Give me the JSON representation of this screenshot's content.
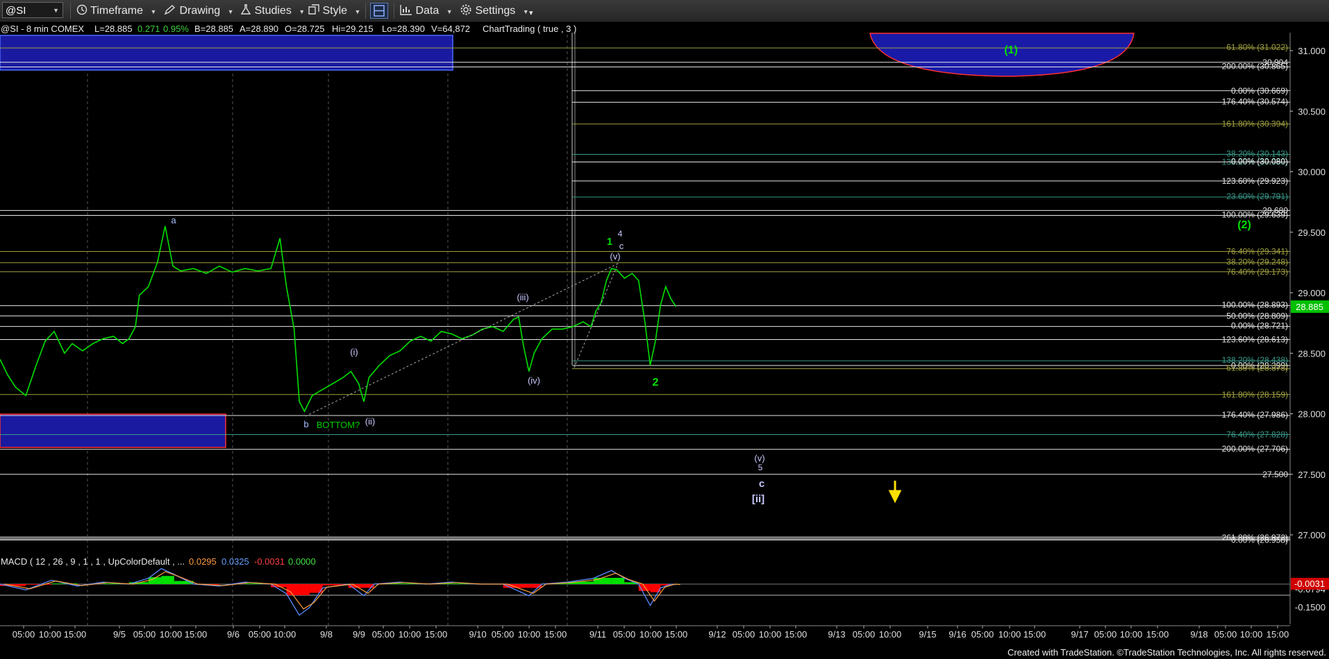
{
  "toolbar": {
    "symbol": "@SI",
    "timeframe": "Timeframe",
    "drawing": "Drawing",
    "studies": "Studies",
    "style": "Style",
    "data": "Data",
    "settings": "Settings"
  },
  "chart_header": {
    "instrument": "@SI - 8 min  COMEX",
    "last": "L=28.885",
    "change": "0.271",
    "pct": "0.95%",
    "bid": "B=28.885",
    "ask": "A=28.890",
    "open": "O=28.725",
    "high": "Hi=29.215",
    "low": "Lo=28.390",
    "volume": "V=64,872",
    "study": "ChartTrading ( true , 3 )"
  },
  "macd_header": {
    "label": "MACD ( 12 , 26 , 9 , 1 , 1 , UpColorDefault , ...",
    "v1": "0.0295",
    "v2": "0.0325",
    "v3": "-0.0031",
    "v4": "0.0000"
  },
  "colors": {
    "price_line": "#00e000",
    "up_hist": "#00e000",
    "down_hist": "#ff0000",
    "fib_white": "#e6e6e6",
    "fib_olive": "#a0a040",
    "fib_teal": "#3a9a8a",
    "box_blue": "#1a1aa0"
  },
  "chart_data": {
    "type": "line",
    "price_axis": [
      "31.000",
      "30.500",
      "30.000",
      "29.500",
      "29.000",
      "28.500",
      "28.000",
      "27.500",
      "27.000"
    ],
    "price_axis_values": [
      31.0,
      30.5,
      30.0,
      29.5,
      29.0,
      28.5,
      28.0,
      27.5,
      27.0
    ],
    "ylim": [
      26.95,
      31.2
    ],
    "last_price": "28.885",
    "last_price_value": 28.885,
    "macd_axis": [
      "-0.0794",
      "-0.1500"
    ],
    "macd_last": "-0.0031",
    "time_axis": [
      "05:00",
      "10:00",
      "15:00",
      "9/5",
      "05:00",
      "10:00",
      "15:00",
      "9/6",
      "05:00",
      "10:00",
      "9/8",
      "9/9",
      "05:00",
      "10:00",
      "15:00",
      "9/10",
      "05:00",
      "10:00",
      "15:00",
      "9/11",
      "05:00",
      "10:00",
      "15:00",
      "9/12",
      "05:00",
      "10:00",
      "15:00",
      "9/13",
      "05:00",
      "10:00",
      "9/15",
      "9/16",
      "05:00",
      "10:00",
      "15:00",
      "9/17",
      "05:00",
      "10:00",
      "15:00",
      "9/18",
      "05:00",
      "10:00",
      "15:00"
    ],
    "fib_levels": [
      {
        "label": "61.80% (31.022)",
        "value": 31.022,
        "color": "olive"
      },
      {
        "label": "30.904",
        "value": 30.904,
        "color": "white"
      },
      {
        "label": "200.00% (30.865)",
        "value": 30.865,
        "color": "white"
      },
      {
        "label": "0.00% (30.669)",
        "value": 30.669,
        "color": "white"
      },
      {
        "label": "176.40% (30.574)",
        "value": 30.574,
        "color": "white"
      },
      {
        "label": "161.80% (30.394)",
        "value": 30.394,
        "color": "olive"
      },
      {
        "label": "38.20% (30.143)",
        "value": 30.143,
        "color": "teal"
      },
      {
        "label": "138.20% (30.080)",
        "value": 30.08,
        "color": "teal"
      },
      {
        "label": "0.00% (30.080)",
        "value": 30.08,
        "color": "white"
      },
      {
        "label": "123.60% (29.923)",
        "value": 29.923,
        "color": "white"
      },
      {
        "label": "23.60% (29.791)",
        "value": 29.791,
        "color": "teal"
      },
      {
        "label": "29.680",
        "value": 29.68,
        "color": "white"
      },
      {
        "label": "100.00% (29.639)",
        "value": 29.639,
        "color": "white"
      },
      {
        "label": "76.40% (29.341)",
        "value": 29.341,
        "color": "olive"
      },
      {
        "label": "38.20% (29.248)",
        "value": 29.248,
        "color": "olive"
      },
      {
        "label": "76.40% (29.173)",
        "value": 29.173,
        "color": "olive"
      },
      {
        "label": "100.00% (28.893)",
        "value": 28.893,
        "color": "white"
      },
      {
        "label": "50.00% (28.809)",
        "value": 28.809,
        "color": "white"
      },
      {
        "label": "0.00% (28.721)",
        "value": 28.721,
        "color": "white"
      },
      {
        "label": "123.60% (28.613)",
        "value": 28.613,
        "color": "white"
      },
      {
        "label": "138.20% (28.438)",
        "value": 28.438,
        "color": "teal"
      },
      {
        "label": "0.00% (28.399)",
        "value": 28.399,
        "color": "white"
      },
      {
        "label": "61.80% (28.373)",
        "value": 28.373,
        "color": "olive"
      },
      {
        "label": "161.80% (28.159)",
        "value": 28.159,
        "color": "olive"
      },
      {
        "label": "176.40% (27.986)",
        "value": 27.986,
        "color": "white"
      },
      {
        "label": "76.40% (27.828)",
        "value": 27.828,
        "color": "teal"
      },
      {
        "label": "200.00% (27.706)",
        "value": 27.706,
        "color": "white"
      },
      {
        "label": "27.500",
        "value": 27.5,
        "color": "white"
      },
      {
        "label": "261.80% (26.972)",
        "value": 26.972,
        "color": "white"
      },
      {
        "label": "0.00% (26.958)",
        "value": 26.958,
        "color": "white"
      }
    ],
    "wave_labels": [
      {
        "text": "a",
        "color": "#a8c0ff"
      },
      {
        "text": "b",
        "color": "#a8c0ff"
      },
      {
        "text": "BOTTOM?",
        "color": "#00d000"
      },
      {
        "text": "(i)",
        "color": "#c8c8ff"
      },
      {
        "text": "(ii)",
        "color": "#c8c8ff"
      },
      {
        "text": "(iii)",
        "color": "#c8c8ff"
      },
      {
        "text": "(iv)",
        "color": "#c8c8ff"
      },
      {
        "text": "(v)",
        "color": "#c8c8ff"
      },
      {
        "text": "1",
        "color": "#00e000"
      },
      {
        "text": "4",
        "color": "#c8c8ff"
      },
      {
        "text": "c",
        "color": "#c8c8ff"
      },
      {
        "text": "2",
        "color": "#00e000"
      },
      {
        "text": "(v)",
        "color": "#c8c8ff"
      },
      {
        "text": "5",
        "color": "#c8c8ff"
      },
      {
        "text": "c",
        "color": "#c8c8ff"
      },
      {
        "text": "[ii]",
        "color": "#c8c8ff"
      },
      {
        "text": "(1)",
        "color": "#00e000"
      },
      {
        "text": "(2)",
        "color": "#00e000"
      }
    ],
    "price_series": [
      [
        0,
        28.45
      ],
      [
        0.006,
        28.32
      ],
      [
        0.012,
        28.22
      ],
      [
        0.02,
        28.15
      ],
      [
        0.028,
        28.4
      ],
      [
        0.035,
        28.6
      ],
      [
        0.042,
        28.68
      ],
      [
        0.05,
        28.5
      ],
      [
        0.056,
        28.58
      ],
      [
        0.064,
        28.52
      ],
      [
        0.072,
        28.58
      ],
      [
        0.08,
        28.62
      ],
      [
        0.088,
        28.64
      ],
      [
        0.095,
        28.58
      ],
      [
        0.1,
        28.62
      ],
      [
        0.105,
        28.72
      ],
      [
        0.108,
        28.98
      ],
      [
        0.115,
        29.05
      ],
      [
        0.122,
        29.25
      ],
      [
        0.128,
        29.55
      ],
      [
        0.134,
        29.22
      ],
      [
        0.14,
        29.18
      ],
      [
        0.15,
        29.2
      ],
      [
        0.16,
        29.16
      ],
      [
        0.17,
        29.22
      ],
      [
        0.18,
        29.17
      ],
      [
        0.19,
        29.2
      ],
      [
        0.2,
        29.18
      ],
      [
        0.21,
        29.2
      ],
      [
        0.217,
        29.45
      ],
      [
        0.222,
        29.05
      ],
      [
        0.228,
        28.7
      ],
      [
        0.232,
        28.1
      ],
      [
        0.236,
        28.02
      ],
      [
        0.242,
        28.15
      ],
      [
        0.25,
        28.2
      ],
      [
        0.258,
        28.25
      ],
      [
        0.266,
        28.3
      ],
      [
        0.272,
        28.35
      ],
      [
        0.278,
        28.25
      ],
      [
        0.282,
        28.1
      ],
      [
        0.286,
        28.3
      ],
      [
        0.294,
        28.4
      ],
      [
        0.302,
        28.48
      ],
      [
        0.31,
        28.52
      ],
      [
        0.318,
        28.6
      ],
      [
        0.326,
        28.64
      ],
      [
        0.334,
        28.6
      ],
      [
        0.342,
        28.68
      ],
      [
        0.35,
        28.66
      ],
      [
        0.358,
        28.62
      ],
      [
        0.366,
        28.65
      ],
      [
        0.374,
        28.7
      ],
      [
        0.382,
        28.72
      ],
      [
        0.39,
        28.68
      ],
      [
        0.398,
        28.78
      ],
      [
        0.402,
        28.8
      ],
      [
        0.406,
        28.55
      ],
      [
        0.41,
        28.35
      ],
      [
        0.414,
        28.5
      ],
      [
        0.42,
        28.62
      ],
      [
        0.428,
        28.7
      ],
      [
        0.436,
        28.7
      ],
      [
        0.444,
        28.72
      ],
      [
        0.452,
        28.76
      ],
      [
        0.458,
        28.72
      ],
      [
        0.462,
        28.85
      ],
      [
        0.466,
        28.92
      ],
      [
        0.47,
        29.1
      ],
      [
        0.474,
        29.2
      ],
      [
        0.478,
        29.19
      ],
      [
        0.484,
        29.12
      ],
      [
        0.49,
        29.16
      ],
      [
        0.495,
        29.1
      ],
      [
        0.5,
        28.75
      ],
      [
        0.504,
        28.4
      ],
      [
        0.508,
        28.6
      ],
      [
        0.512,
        28.9
      ],
      [
        0.516,
        29.05
      ],
      [
        0.52,
        28.95
      ],
      [
        0.524,
        28.885
      ]
    ],
    "macd_series": [
      [
        0,
        0.0
      ],
      [
        0.02,
        -0.03
      ],
      [
        0.04,
        0.02
      ],
      [
        0.06,
        -0.01
      ],
      [
        0.08,
        0.01
      ],
      [
        0.1,
        0.0
      ],
      [
        0.115,
        0.03
      ],
      [
        0.125,
        0.08
      ],
      [
        0.135,
        0.05
      ],
      [
        0.15,
        0.0
      ],
      [
        0.17,
        -0.01
      ],
      [
        0.19,
        0.01
      ],
      [
        0.21,
        0.0
      ],
      [
        0.222,
        -0.05
      ],
      [
        0.232,
        -0.16
      ],
      [
        0.24,
        -0.12
      ],
      [
        0.25,
        -0.02
      ],
      [
        0.27,
        0.0
      ],
      [
        0.282,
        -0.06
      ],
      [
        0.29,
        0.0
      ],
      [
        0.31,
        0.01
      ],
      [
        0.33,
        0.0
      ],
      [
        0.35,
        0.01
      ],
      [
        0.37,
        0.0
      ],
      [
        0.39,
        0.0
      ],
      [
        0.41,
        -0.06
      ],
      [
        0.42,
        0.0
      ],
      [
        0.44,
        0.01
      ],
      [
        0.46,
        0.03
      ],
      [
        0.474,
        0.07
      ],
      [
        0.484,
        0.03
      ],
      [
        0.495,
        0.0
      ],
      [
        0.504,
        -0.11
      ],
      [
        0.512,
        -0.02
      ],
      [
        0.52,
        0.0
      ],
      [
        0.524,
        -0.0031
      ]
    ]
  },
  "footer": "Created with TradeStation. ©TradeStation Technologies, Inc. All rights reserved."
}
